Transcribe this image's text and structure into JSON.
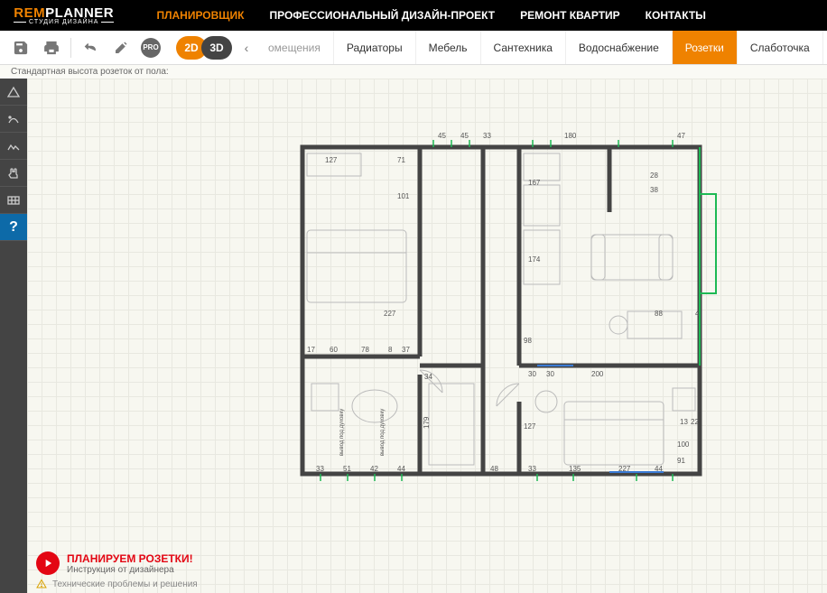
{
  "logo": {
    "part1": "REM",
    "part2": "PLANNER",
    "sub": "СТУДИЯ ДИЗАЙНА"
  },
  "nav": {
    "planner": "ПЛАНИРОВЩИК",
    "design": "ПРОФЕССИОНАЛЬНЫЙ ДИЗАЙН-ПРОЕКТ",
    "repair": "РЕМОНТ КВАРТИР",
    "contacts": "КОНТАКТЫ"
  },
  "toolbar": {
    "pro": "PRO",
    "view2d": "2D",
    "view3d": "3D"
  },
  "tabs": {
    "rooms": "омещения",
    "radiators": "Радиаторы",
    "furniture": "Мебель",
    "plumbing": "Сантехника",
    "water": "Водоснабжение",
    "sockets": "Розетки",
    "lowvoltage": "Слаботочка"
  },
  "hint": "Стандартная высота розеток от пола:",
  "sidebar": {
    "help": "?"
  },
  "dimensions": {
    "top": [
      "45",
      "45",
      "33",
      "180",
      "47"
    ],
    "r1": "127",
    "r2": "71",
    "r3": "167",
    "r4": "28",
    "r5": "38",
    "r6": "101",
    "r7": "174",
    "r8": "227",
    "r9": "88",
    "b1": [
      "17",
      "60",
      "78",
      "8",
      "37"
    ],
    "r10": "34",
    "b2": "98",
    "b3": [
      "30",
      "30",
      "200"
    ],
    "r11": "127",
    "r12": "179",
    "bot1": [
      "33",
      "51",
      "42",
      "44"
    ],
    "r13": "48",
    "bot2": [
      "33",
      "135",
      "227",
      "44"
    ],
    "r14": "100",
    "r15": "91",
    "r16": "13",
    "r17": "22",
    "r18": "4",
    "labels": [
      "вывод под духовку",
      "вывод под духовку"
    ]
  },
  "promo": {
    "title": "ПЛАНИРУЕМ РОЗЕТКИ!",
    "sub": "Инструкция от дизайнера"
  },
  "tech": "Технические проблемы и решения"
}
